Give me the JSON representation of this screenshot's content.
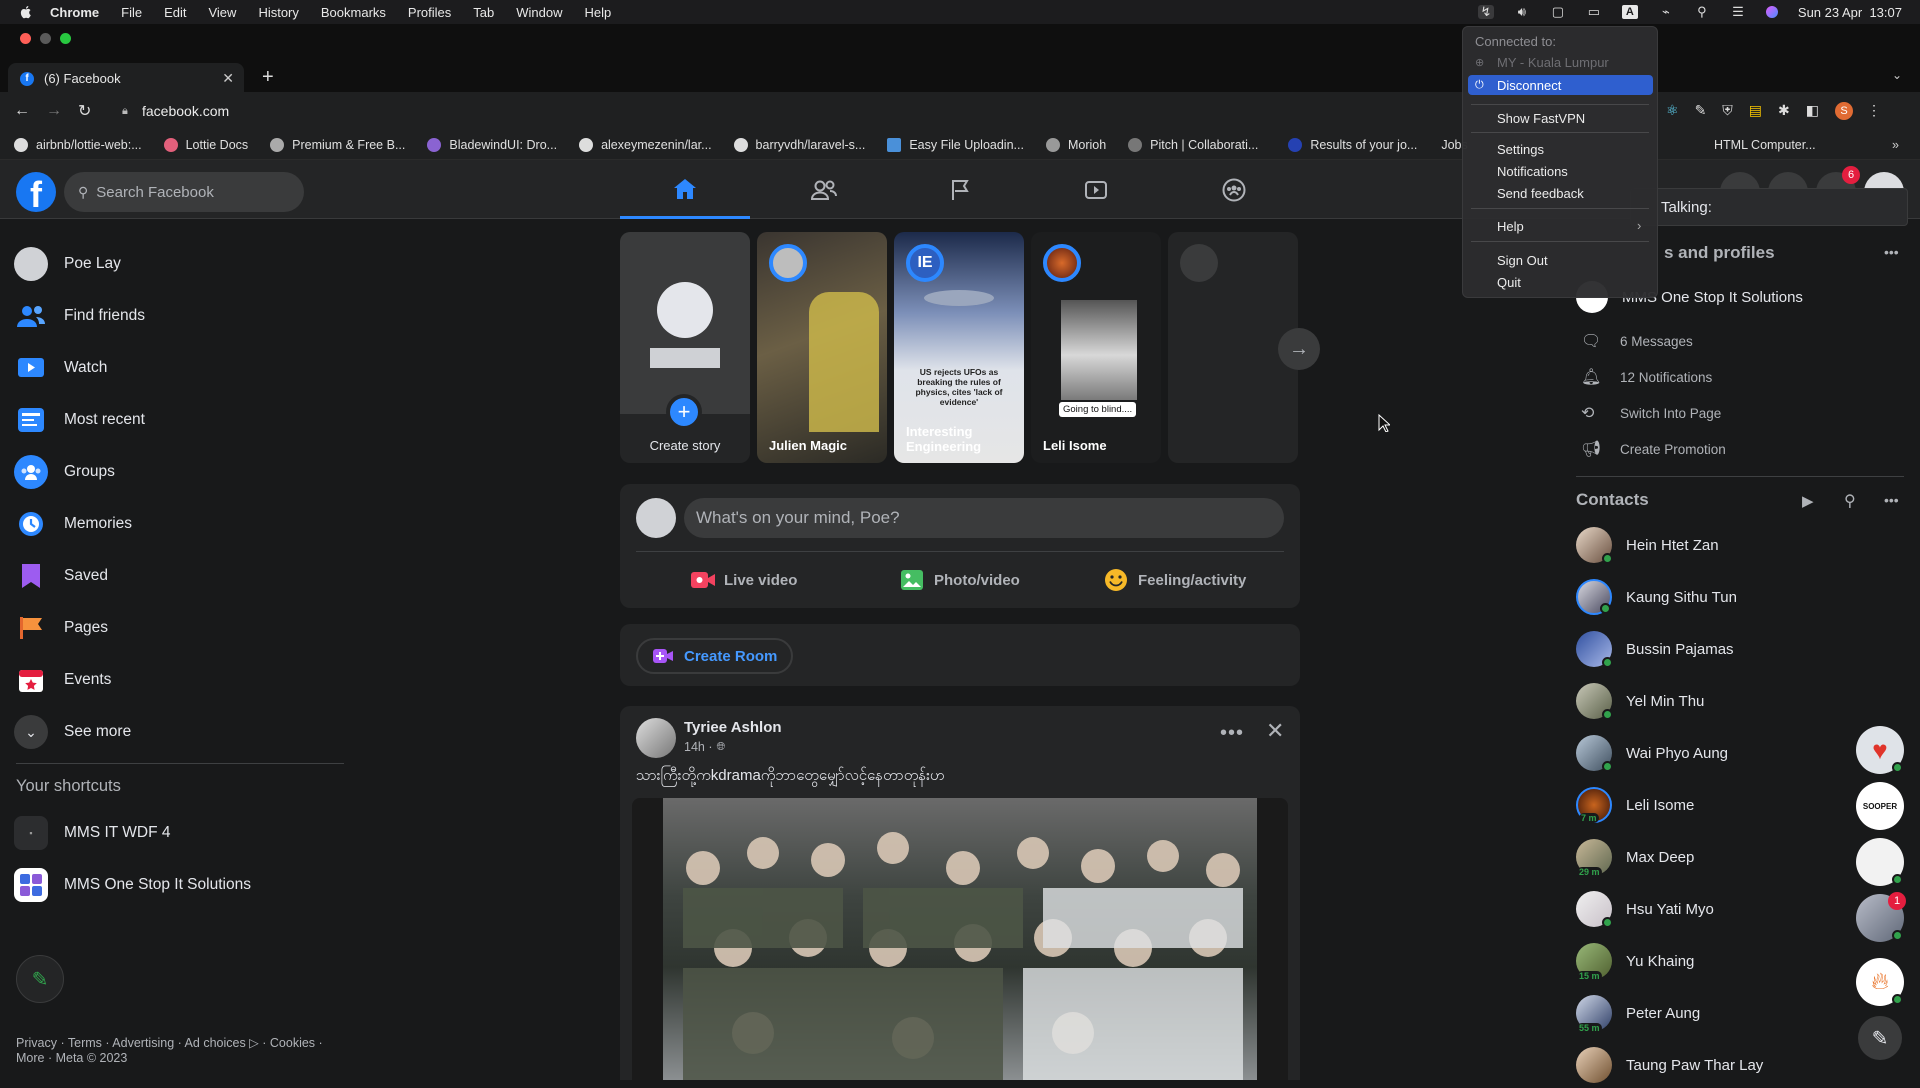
{
  "menubar": {
    "app": "Chrome",
    "items": [
      "File",
      "Edit",
      "View",
      "History",
      "Bookmarks",
      "Profiles",
      "Tab",
      "Window",
      "Help"
    ],
    "clock": "Sun 23 Apr  13:07"
  },
  "vpn_menu": {
    "connected_label": "Connected to:",
    "location": "MY - Kuala Lumpur",
    "disconnect": "Disconnect",
    "show": "Show FastVPN",
    "settings": "Settings",
    "notifications": "Notifications",
    "feedback": "Send feedback",
    "help": "Help",
    "signout": "Sign Out",
    "quit": "Quit"
  },
  "tooltip": {
    "talking": "Talking:"
  },
  "tab": {
    "title": "(6) Facebook"
  },
  "address": {
    "url": "facebook.com"
  },
  "bookmarks": [
    "airbnb/lottie-web:...",
    "Lottie Docs",
    "Premium & Free B...",
    "BladewindUI: Dro...",
    "alexeymezenin/lar...",
    "barryvdh/laravel-s...",
    "Easy File Uploadin...",
    "Morioh",
    "Pitch | Collaborati...",
    "Results of your jo...",
    "Jobs",
    "HTML Computer..."
  ],
  "fb": {
    "search_placeholder": "Search Facebook",
    "notification_badge": "6"
  },
  "left": {
    "user": "Poe Lay",
    "items": [
      "Find friends",
      "Watch",
      "Most recent",
      "Groups",
      "Memories",
      "Saved",
      "Pages",
      "Events",
      "See more"
    ],
    "shortcuts_title": "Your shortcuts",
    "shortcuts": [
      "MMS IT WDF 4",
      "MMS One Stop It Solutions"
    ],
    "footer1": "Privacy · Terms · Advertising · Ad choices ▷ · Cookies ·",
    "footer2": "More · Meta © 2023"
  },
  "stories": {
    "create": "Create story",
    "items": [
      "Julien Magic",
      "Interesting Engineering",
      "Leli Isome"
    ],
    "ufo_headline": "US rejects UFOs as breaking the rules of physics, cites 'lack of evidence'",
    "leli_caption": "Going to blind....",
    "brand": "IE"
  },
  "composer": {
    "placeholder": "What's on your mind, Poe?",
    "live": "Live video",
    "photo": "Photo/video",
    "feeling": "Feeling/activity"
  },
  "room": {
    "label": "Create Room"
  },
  "post": {
    "author": "Tyriee Ashlon",
    "time": "14h ·",
    "text": "သားကြီးတို့ကkdramaကိုဘာတွေမျှော်လင့်နေတာတုန်းဟ"
  },
  "right": {
    "pages_title": "s and profiles",
    "page_name": "MMS One Stop It Solutions",
    "messages": "6 Messages",
    "notifications": "12 Notifications",
    "switch": "Switch Into Page",
    "promo": "Create Promotion",
    "contacts_title": "Contacts",
    "contacts": [
      {
        "name": "Hein Htet Zan",
        "badge": ""
      },
      {
        "name": "Kaung Sithu Tun",
        "badge": ""
      },
      {
        "name": "Bussin Pajamas",
        "badge": ""
      },
      {
        "name": "Yel Min Thu",
        "badge": ""
      },
      {
        "name": "Wai Phyo Aung",
        "badge": ""
      },
      {
        "name": "Leli Isome",
        "badge": "7 m"
      },
      {
        "name": "Max Deep",
        "badge": "29 m"
      },
      {
        "name": "Hsu Yati Myo",
        "badge": ""
      },
      {
        "name": "Yu Khaing",
        "badge": "15 m"
      },
      {
        "name": "Peter Aung",
        "badge": "55 m"
      },
      {
        "name": "Taung Paw Thar Lay",
        "badge": ""
      }
    ],
    "bubble_badge": "1",
    "sooper": "SOOPER"
  },
  "colors": {
    "fb_blue": "#2d88ff",
    "bg": "#18191a",
    "card": "#242526"
  }
}
